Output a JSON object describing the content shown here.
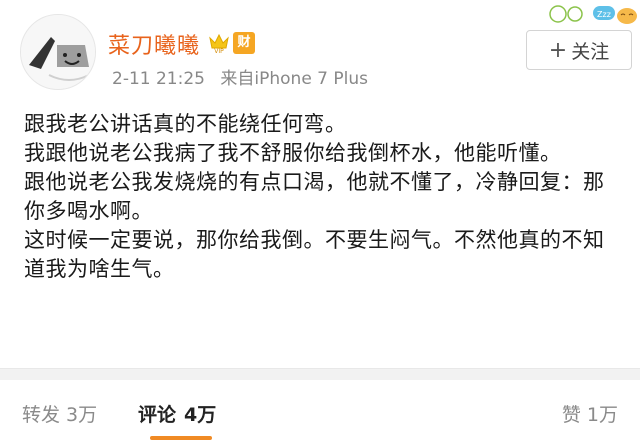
{
  "post": {
    "username": "菜刀曦曦",
    "badge_cai": "财",
    "date": "2-11 21:25",
    "source": "来自iPhone 7 Plus",
    "follow_label": "关注",
    "lines": [
      "跟我老公讲话真的不能绕任何弯。",
      "我跟他说老公我病了我不舒服你给我倒杯水，他能听懂。",
      "跟他说老公我发烧烧的有点口渴，他就不懂了，冷静回复：那你多喝水啊。",
      "这时候一定要说，那你给我倒。不要生闷气。不然他真的不知道我为啥生气。"
    ]
  },
  "footer": {
    "repost_label": "转发",
    "repost_count": "3万",
    "comment_label": "评论",
    "comment_count": "4万",
    "like_label": "赞",
    "like_count": "1万"
  },
  "deco": {
    "badge_text": "Zzz"
  },
  "colors": {
    "username": "#e8631c",
    "accent": "#f08a24"
  }
}
